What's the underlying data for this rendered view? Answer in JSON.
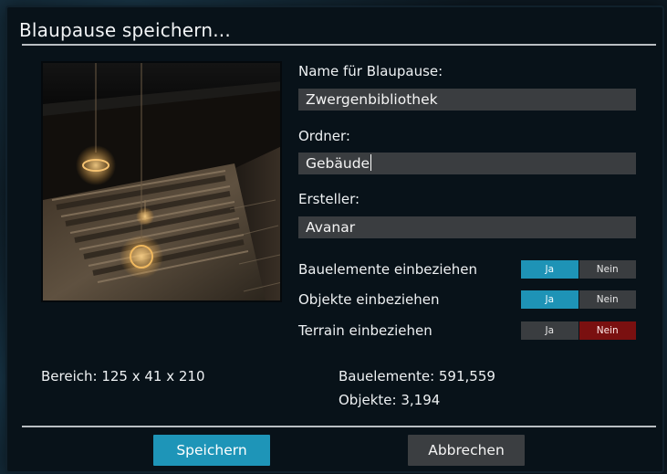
{
  "dialog": {
    "title": "Blaupause speichern..."
  },
  "form": {
    "name_label": "Name für Blaupause:",
    "name_value": "Zwergenbibliothek",
    "folder_label": "Ordner:",
    "folder_value": "Gebäude",
    "creator_label": "Ersteller:",
    "creator_value": "Avanar"
  },
  "options": [
    {
      "label": "Bauelemente einbeziehen",
      "yes": "Ja",
      "no": "Nein",
      "selected": "yes"
    },
    {
      "label": "Objekte einbeziehen",
      "yes": "Ja",
      "no": "Nein",
      "selected": "yes"
    },
    {
      "label": "Terrain einbeziehen",
      "yes": "Ja",
      "no": "Nein",
      "selected": "no"
    }
  ],
  "stats": {
    "range": "Bereich: 125 x 41 x 210",
    "building_elements": "Bauelemente: 591,559",
    "objects": "Objekte: 3,194"
  },
  "buttons": {
    "save": "Speichern",
    "cancel": "Abbrechen"
  },
  "colors": {
    "accent": "#1e95b8",
    "danger": "#7a1010",
    "panel": "#081219",
    "field": "#3a3d40"
  }
}
